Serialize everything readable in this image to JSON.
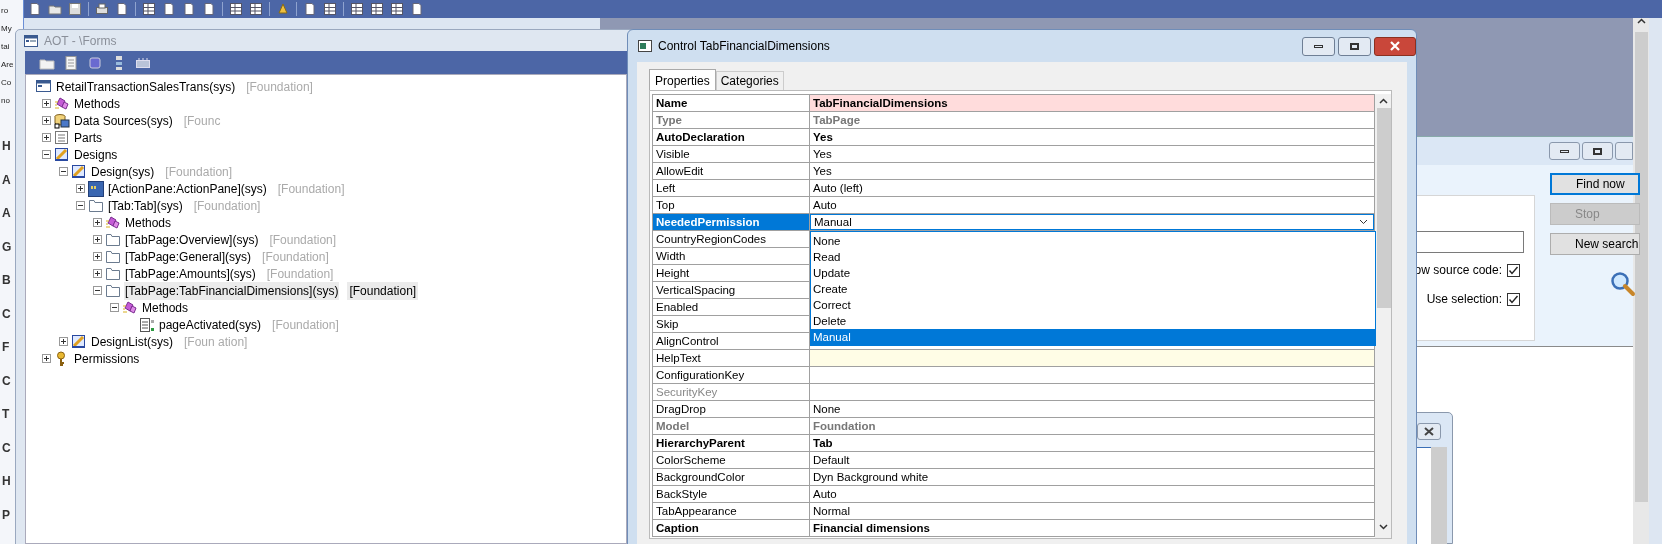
{
  "left_edge_fragments": {
    "top": [
      "ro",
      "My",
      "tai",
      "Are",
      "Co",
      "no"
    ],
    "bottom": [
      "H",
      "A",
      "A",
      "G",
      "B",
      "C",
      "F",
      "C",
      "T",
      "C",
      "H",
      "P"
    ]
  },
  "aot_window": {
    "title": "AOT - \\Forms",
    "tree": [
      {
        "label": "RetailTransactionSalesTrans(sys)",
        "tag": "[Foundation]",
        "kind": "form",
        "selected": false,
        "children": [
          {
            "label": "Methods",
            "kind": "methods",
            "expanded": false,
            "selected": false
          },
          {
            "label": "Data Sources(sys)",
            "tag": "[Founc",
            "kind": "datasources",
            "expanded": false,
            "selected": false
          },
          {
            "label": "Parts",
            "kind": "parts",
            "expanded": false,
            "selected": false
          },
          {
            "label": "Designs",
            "kind": "design",
            "expanded": true,
            "selected": false,
            "children": [
              {
                "label": "Design(sys)",
                "tag": "[Foundation]",
                "kind": "design",
                "expanded": true,
                "selected": false,
                "children": [
                  {
                    "label": "[ActionPane:ActionPane](sys)",
                    "tag": "[Foundation]",
                    "kind": "actionpane",
                    "expanded": false,
                    "selected": false
                  },
                  {
                    "label": "[Tab:Tab](sys)",
                    "tag": "[Foundation]",
                    "kind": "tab",
                    "expanded": true,
                    "selected": false,
                    "children": [
                      {
                        "label": "Methods",
                        "kind": "methods",
                        "expanded": false,
                        "selected": false
                      },
                      {
                        "label": "[TabPage:Overview](sys)",
                        "tag": "[Foundation]",
                        "kind": "tab",
                        "expanded": false,
                        "selected": false
                      },
                      {
                        "label": "[TabPage:General](sys)",
                        "tag": "[Foundation]",
                        "kind": "tab",
                        "expanded": false,
                        "selected": false
                      },
                      {
                        "label": "[TabPage:Amounts](sys)",
                        "tag": "[Foundation]",
                        "kind": "tab",
                        "expanded": false,
                        "selected": false
                      },
                      {
                        "label": "[TabPage:TabFinancialDimensions](sys)",
                        "tag": "[Foundation]",
                        "kind": "tab",
                        "expanded": true,
                        "selected": true,
                        "children": [
                          {
                            "label": "Methods",
                            "kind": "methods",
                            "expanded": true,
                            "selected": false,
                            "children": [
                              {
                                "label": "pageActivated(sys)",
                                "tag": "[Foundation]",
                                "kind": "method",
                                "selected": false
                              }
                            ]
                          }
                        ]
                      }
                    ]
                  }
                ]
              },
              {
                "label": "DesignList(sys)",
                "tag": "[Foun ation]",
                "kind": "design",
                "expanded": false,
                "selected": false
              }
            ]
          },
          {
            "label": "Permissions",
            "kind": "key",
            "expanded": false,
            "selected": false
          }
        ]
      }
    ]
  },
  "properties_window": {
    "title": "Control TabFinancialDimensions",
    "tabs": [
      {
        "label": "Properties",
        "selected": true
      },
      {
        "label": "Categories",
        "selected": false
      }
    ],
    "rows": [
      {
        "name": "Name",
        "value": "TabFinancialDimensions",
        "kind": "bold",
        "selected": false,
        "color": "#ffdcdc"
      },
      {
        "name": "Type",
        "value": "TabPage",
        "kind": "bold_grey",
        "selected": false
      },
      {
        "name": "AutoDeclaration",
        "value": "Yes",
        "kind": "bold",
        "selected": false
      },
      {
        "name": "Visible",
        "value": "Yes",
        "kind": "normal",
        "selected": false
      },
      {
        "name": "AllowEdit",
        "value": "Yes",
        "kind": "normal",
        "selected": false
      },
      {
        "name": "Left",
        "value": "Auto (left)",
        "kind": "normal",
        "selected": false
      },
      {
        "name": "Top",
        "value": "Auto",
        "kind": "normal",
        "selected": false
      },
      {
        "name": "NeededPermission",
        "value": "Manual",
        "kind": "bold",
        "selected": true,
        "dropdown": {
          "options": [
            {
              "label": "None",
              "selected": false
            },
            {
              "label": "Read",
              "selected": false
            },
            {
              "label": "Update",
              "selected": false
            },
            {
              "label": "Create",
              "selected": false
            },
            {
              "label": "Correct",
              "selected": false
            },
            {
              "label": "Delete",
              "selected": false
            },
            {
              "label": "Manual",
              "selected": true
            }
          ]
        }
      },
      {
        "name": "CountryRegionCodes",
        "kind": "normal",
        "selected": false
      },
      {
        "name": "Width",
        "kind": "normal",
        "selected": false
      },
      {
        "name": "Height",
        "kind": "normal",
        "selected": false
      },
      {
        "name": "VerticalSpacing",
        "kind": "normal",
        "selected": false
      },
      {
        "name": "Enabled",
        "kind": "normal",
        "selected": false
      },
      {
        "name": "Skip",
        "kind": "normal",
        "selected": false
      },
      {
        "name": "AlignControl",
        "kind": "normal",
        "selected": false
      },
      {
        "name": "HelpText",
        "kind": "normal",
        "selected": false,
        "color": "#fffde6"
      },
      {
        "name": "ConfigurationKey",
        "kind": "normal",
        "selected": false
      },
      {
        "name": "SecurityKey",
        "kind": "grey",
        "selected": false
      },
      {
        "name": "DragDrop",
        "value": "None",
        "kind": "normal",
        "selected": false
      },
      {
        "name": "Model",
        "value": "Foundation",
        "kind": "bold_grey",
        "selected": false
      },
      {
        "name": "HierarchyParent",
        "value": "Tab",
        "kind": "bold",
        "selected": false
      },
      {
        "name": "ColorScheme",
        "value": "Default",
        "kind": "normal",
        "selected": false
      },
      {
        "name": "BackgroundColor",
        "value": "Dyn Background white",
        "kind": "normal",
        "selected": false
      },
      {
        "name": "BackStyle",
        "value": "Auto",
        "kind": "normal",
        "selected": false
      },
      {
        "name": "TabAppearance",
        "value": "Normal",
        "kind": "normal",
        "selected": false
      },
      {
        "name": "Caption",
        "value": "Financial dimensions",
        "kind": "bold",
        "selected": false
      }
    ]
  },
  "find_window": {
    "options": [
      {
        "label": "ow source code:",
        "checked": true
      },
      {
        "label": "Use selection:",
        "checked": true
      }
    ],
    "buttons": [
      {
        "label": "Find now",
        "default": true,
        "disabled": false
      },
      {
        "label": "Stop",
        "default": false,
        "disabled": true
      },
      {
        "label": "New search",
        "default": false,
        "disabled": false
      }
    ]
  }
}
